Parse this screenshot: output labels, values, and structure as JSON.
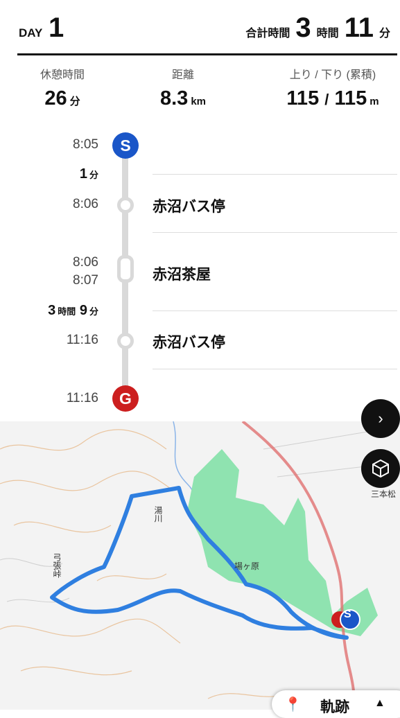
{
  "header": {
    "day_label": "DAY",
    "day_number": "1",
    "total_label": "合計時間",
    "total_hours": "3",
    "hours_label": "時間",
    "total_minutes": "11",
    "minutes_label": "分"
  },
  "stats": {
    "rest": {
      "label": "休憩時間",
      "value": "26",
      "unit": "分"
    },
    "distance": {
      "label": "距離",
      "value": "8.3",
      "unit": "km"
    },
    "elevation": {
      "label": "上り / 下り (累積)",
      "up": "115",
      "slash": "/",
      "down": "115",
      "unit": "m"
    }
  },
  "timeline": {
    "start": {
      "time": "8:05",
      "marker": "S",
      "color": "#1a56c8"
    },
    "leg1_duration": {
      "value": "1",
      "unit": "分"
    },
    "stop1": {
      "time": "8:06",
      "place": "赤沼バス停"
    },
    "stop2": {
      "arrive": "8:06",
      "depart": "8:07",
      "place": "赤沼茶屋"
    },
    "leg2_duration": {
      "hours": "3",
      "hours_unit": "時間",
      "minutes": "9",
      "minutes_unit": "分"
    },
    "stop3": {
      "time": "11:16",
      "place": "赤沼バス停"
    },
    "goal": {
      "time": "11:16",
      "marker": "G",
      "color": "#cc1f1f"
    }
  },
  "map": {
    "labels": {
      "sanbonmatsu": "三本松",
      "yugawa": "湯川",
      "pass": "弓張峠",
      "senjogahara": "場ヶ原"
    },
    "colors": {
      "route": "#2f7fe0",
      "forest": "#8fe3b0",
      "road": "#e07070"
    },
    "fab_forward": "arrow-right-icon",
    "fab_3d": "cube-icon",
    "start_pin": "S"
  },
  "track_button": {
    "label": "軌跡",
    "icon": "map-pin-icon",
    "caret": "chevron-up-icon"
  }
}
